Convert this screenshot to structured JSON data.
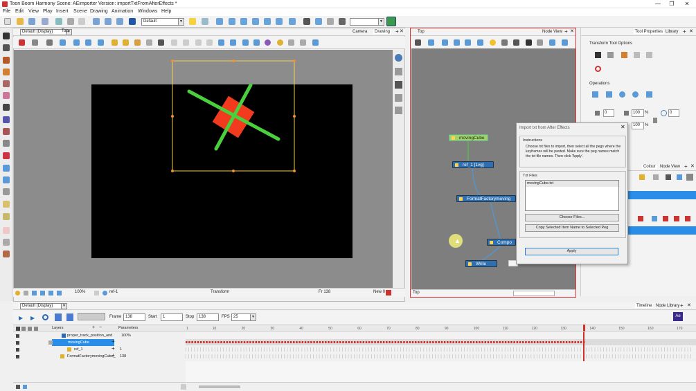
{
  "app": {
    "title": "Toon Boom Harmony Scene: AEimporter Version: importTxtFromAfterEffects *",
    "controls": {
      "minimize": "—",
      "maximize": "❐",
      "close": "✕"
    }
  },
  "menu": [
    "File",
    "Edit",
    "View",
    "Play",
    "Insert",
    "Scene",
    "Drawing",
    "Animation",
    "Windows",
    "Help"
  ],
  "toolbar": {
    "workspace": "Default"
  },
  "camera": {
    "view_select": "Default (Display)",
    "top_label": "Top",
    "tabs": [
      "Camera",
      "Drawing"
    ],
    "zoom": "100%",
    "current_node": "ref-1",
    "tool": "Transform",
    "frame": "Fr 138",
    "new": "New 0"
  },
  "nodeview": {
    "top_label": "Top",
    "tab": "Node View",
    "bottom_label": "Top",
    "nodes": {
      "movingcube": "movingCube",
      "ref1": "ref_1 [1vg]",
      "formatfactory": "FormatFactorymoving",
      "composite": "Compo",
      "write": "Write"
    }
  },
  "rightpanel": {
    "tabs": [
      "Tool Properties",
      "Library"
    ],
    "section": "Transform Tool Options",
    "operations": "Operations",
    "fields": {
      "x": "0",
      "w": "100",
      "h": "100",
      "rot": "0"
    },
    "percent": "%",
    "lower_tabs": [
      "Colour",
      "Node View"
    ]
  },
  "dialog": {
    "title": "Import txt from After Effects",
    "instructions_label": "Instructions",
    "instructions": "Choose txt files to import, then select all the pegs where the keyframes will be pasted. Make sure the peg names match the txt file names. Then click 'Apply'.",
    "files_label": "Txt Files",
    "files": [
      "movingCube.txt"
    ],
    "choose_button": "Choose Files...",
    "copy_button": "Copy Selected Item Name to Selected Peg",
    "apply_button": "Apply"
  },
  "timeline": {
    "view_select": "Default (Display)",
    "tabs": [
      "Timeline",
      "Node Library"
    ],
    "frame_label": "Frame",
    "frame": "138",
    "start_label": "Start",
    "start": "1",
    "stop_label": "Stop",
    "stop": "138",
    "fps_label": "FPS",
    "fps": "25",
    "col_layers": "Layers",
    "col_params": "Parameters",
    "layers": [
      {
        "name": "proper_track_position_and",
        "param": "100%"
      },
      {
        "name": "movingCube",
        "param": ""
      },
      {
        "name": "ref_1",
        "param": "1"
      },
      {
        "name": "FormatFactorymovingCube_",
        "param": "138"
      }
    ],
    "ruler": [
      "1",
      "10",
      "20",
      "30",
      "40",
      "50",
      "60",
      "70",
      "80",
      "90",
      "100",
      "110",
      "120",
      "130",
      "140",
      "150",
      "160",
      "170"
    ],
    "current_frame": 138,
    "total_frames": 175
  },
  "colors": {
    "accent": "#3f8fd9",
    "selection": "#2a8ee8",
    "keyframe": "#d0302b",
    "green_peg": "#2f6fb0",
    "peg_green": "#4bcf3c",
    "cube": "#f23a1e"
  }
}
